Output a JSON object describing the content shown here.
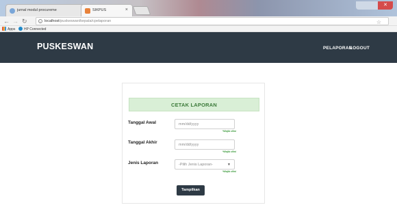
{
  "browser": {
    "tabs": [
      {
        "title": "jurnal modul procureme",
        "close": "×"
      },
      {
        "title": "SIKPUS",
        "close": "×"
      }
    ],
    "address": {
      "host": "localhost",
      "path": "/puskeswan/kepala/cpelaporan"
    },
    "bookmarks": [
      {
        "label": "Apps"
      },
      {
        "label": "HP Connected"
      }
    ]
  },
  "navbar": {
    "brand": "PUSKESWAN",
    "links": [
      "PELAPORAN",
      "LOGOUT"
    ]
  },
  "form": {
    "title": "CETAK LAPORAN",
    "fields": [
      {
        "label": "Tanggal Awal",
        "placeholder": "mm/dd/yyyy",
        "hint": "*Wajib diisi"
      },
      {
        "label": "Tanggal Akhir",
        "placeholder": "mm/dd/yyyy",
        "hint": "*Wajib diisi"
      },
      {
        "label": "Jenis Laporan",
        "selected": "-Pilih Jenis Laporan-",
        "hint": "*Wajib diisi"
      }
    ],
    "submit": "Tampilkan"
  },
  "colors": {
    "navbar": "#2e3a45",
    "header_bg": "#d9efd6",
    "header_text": "#3c7a3a",
    "hint": "#3c9a3c"
  }
}
